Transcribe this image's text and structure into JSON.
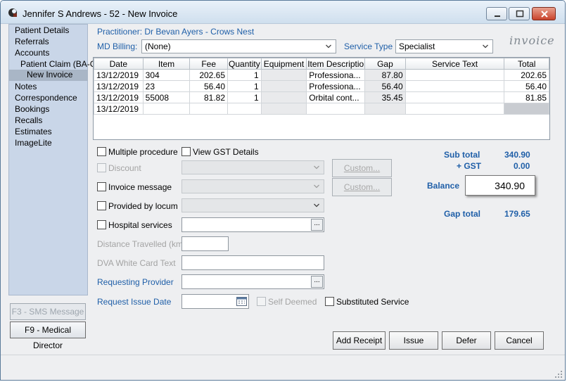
{
  "window": {
    "title": "Jennifer S Andrews - 52 - New Invoice"
  },
  "sidebar": {
    "items": [
      {
        "label": "Patient Details"
      },
      {
        "label": "Referrals"
      },
      {
        "label": "Accounts"
      },
      {
        "label": "Patient Claim (BA-CN"
      },
      {
        "label": "New Invoice"
      },
      {
        "label": "Notes"
      },
      {
        "label": "Correspondence"
      },
      {
        "label": "Bookings"
      },
      {
        "label": "Recalls"
      },
      {
        "label": "Estimates"
      },
      {
        "label": "ImageLite"
      }
    ],
    "sms_button": "F3 - SMS Message",
    "md_button": "F9 - Medical Director"
  },
  "header": {
    "practitioner": "Practitioner:  Dr Bevan Ayers - Crows Nest",
    "md_billing_label": "MD Billing:",
    "md_billing_value": "(None)",
    "service_type_label": "Service Type",
    "service_type_value": "Specialist",
    "invoice_word": "invoice"
  },
  "grid": {
    "columns": [
      "Date",
      "Item",
      "Fee",
      "Quantity",
      "Equipment",
      "Item Descriptio",
      "Gap",
      "Service Text",
      "Total"
    ],
    "rows": [
      {
        "date": "13/12/2019",
        "item": "304",
        "fee": "202.65",
        "qty": "1",
        "equipment": "",
        "desc": "Professiona...",
        "gap": "87.80",
        "service_text": "",
        "total": "202.65"
      },
      {
        "date": "13/12/2019",
        "item": "23",
        "fee": "56.40",
        "qty": "1",
        "equipment": "",
        "desc": "Professiona...",
        "gap": "56.40",
        "service_text": "",
        "total": "56.40"
      },
      {
        "date": "13/12/2019",
        "item": "55008",
        "fee": "81.82",
        "qty": "1",
        "equipment": "",
        "desc": "Orbital cont...",
        "gap": "35.45",
        "service_text": "",
        "total": "81.85"
      },
      {
        "date": "13/12/2019",
        "item": "",
        "fee": "",
        "qty": "",
        "equipment": "",
        "desc": "",
        "gap": "",
        "service_text": "",
        "total": ""
      }
    ]
  },
  "form": {
    "multiple_procedure": "Multiple procedure",
    "view_gst": "View GST Details",
    "discount": "Discount",
    "invoice_message": "Invoice message",
    "provided_by_locum": "Provided by locum",
    "hospital_services": "Hospital services",
    "distance_travelled": "Distance Travelled (km)",
    "dva_white_card": "DVA White Card Text",
    "requesting_provider": "Requesting Provider",
    "request_issue_date": "Request Issue Date",
    "self_deemed": "Self Deemed",
    "substituted_service": "Substituted Service",
    "custom_label": "Custom..."
  },
  "totals": {
    "sub_total_label": "Sub total",
    "sub_total": "340.90",
    "gst_label": "+ GST",
    "gst": "0.00",
    "balance_label": "Balance",
    "balance": "340.90",
    "gap_total_label": "Gap total",
    "gap_total": "179.65"
  },
  "actions": {
    "add_receipt": "Add Receipt",
    "issue": "Issue",
    "defer": "Defer",
    "cancel": "Cancel"
  }
}
